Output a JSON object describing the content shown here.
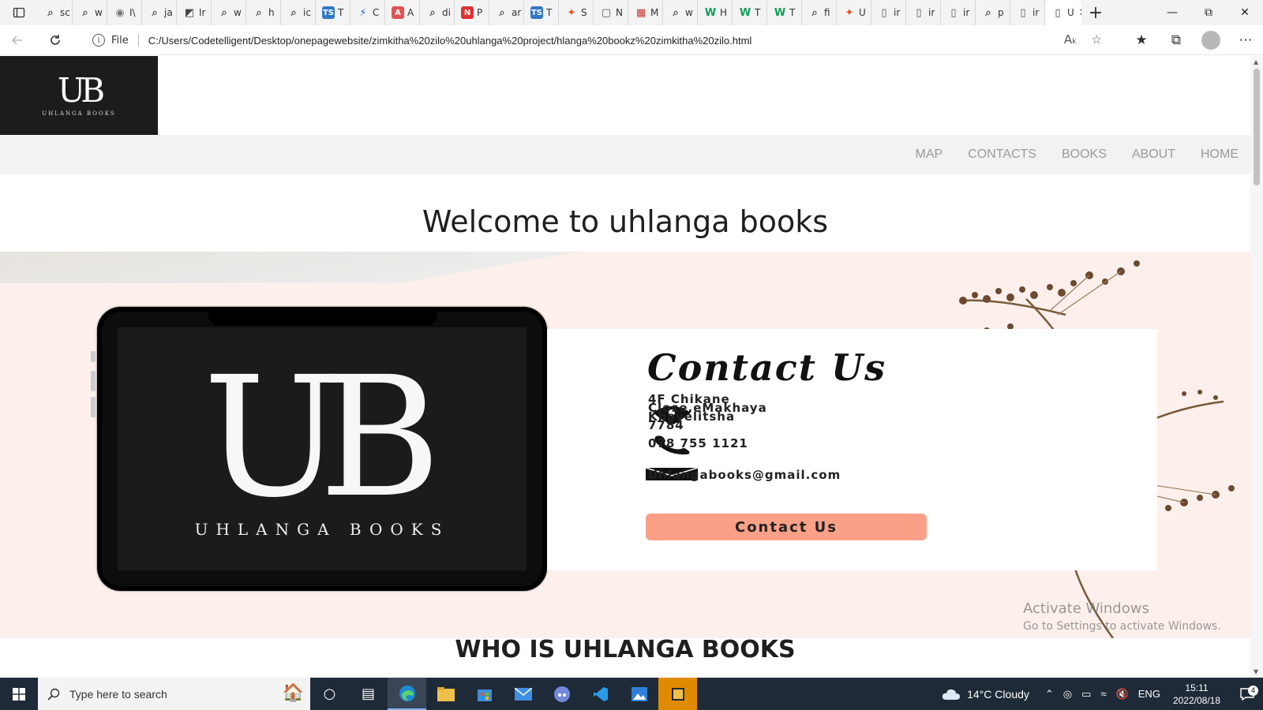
{
  "browser": {
    "tabs": [
      {
        "label": "sc",
        "icon": "search-icon"
      },
      {
        "label": "w",
        "icon": "search-icon"
      },
      {
        "label": "I\\",
        "icon": "account-icon"
      },
      {
        "label": "ja",
        "icon": "search-icon"
      },
      {
        "label": "Ir",
        "icon": "image-icon"
      },
      {
        "label": "w",
        "icon": "search-icon"
      },
      {
        "label": "h",
        "icon": "search-icon"
      },
      {
        "label": "ic",
        "icon": "search-icon"
      },
      {
        "label": "T",
        "icon": "ts-icon"
      },
      {
        "label": "C",
        "icon": "bolt-icon"
      },
      {
        "label": "A",
        "icon": "a-icon"
      },
      {
        "label": "di",
        "icon": "search-icon"
      },
      {
        "label": "P",
        "icon": "new-icon"
      },
      {
        "label": "ar",
        "icon": "search-icon"
      },
      {
        "label": "T",
        "icon": "ts-icon"
      },
      {
        "label": "S",
        "icon": "figma-icon"
      },
      {
        "label": "N",
        "icon": "window-icon"
      },
      {
        "label": "M",
        "icon": "calendar-icon"
      },
      {
        "label": "w",
        "icon": "search-icon"
      },
      {
        "label": "H",
        "icon": "w-icon"
      },
      {
        "label": "T",
        "icon": "w-icon"
      },
      {
        "label": "T",
        "icon": "w-icon"
      },
      {
        "label": "fi",
        "icon": "search-icon"
      },
      {
        "label": "U",
        "icon": "figma-icon"
      },
      {
        "label": "ir",
        "icon": "file-icon"
      },
      {
        "label": "ir",
        "icon": "file-icon"
      },
      {
        "label": "ir",
        "icon": "file-icon"
      },
      {
        "label": "p",
        "icon": "search-icon"
      },
      {
        "label": "ir",
        "icon": "file-icon"
      }
    ],
    "active_tab": {
      "label": "U",
      "icon": "file-icon"
    },
    "address": {
      "scheme_label": "File",
      "url": "C:/Users/Codetelligent/Desktop/onepagewebsite/zimkitha%20zilo%20uhlanga%20project/hlanga%20bookz%20zimkitha%20zilo.html"
    }
  },
  "site": {
    "logo": {
      "mark": "UB",
      "text": "UHLANGA BOOKS"
    },
    "nav": [
      "MAP",
      "CONTACTS",
      "BOOKS",
      "ABOUT",
      "HOME"
    ],
    "welcome_heading": "Welcome to uhlanga books",
    "banner": {
      "phone_logo_mark": "UB",
      "phone_logo_text": "UHLANGA BOOKS",
      "contact_title": "Contact Us",
      "address": "4F Chikane\nClose,eMakhaya\nKhayelitsha\n7784",
      "phone": "078 755 1121",
      "email": "Uhlangabooks@gmail.com",
      "button_label": "Contact Us"
    },
    "section_heading": "WHO IS UHLANGA BOOKS"
  },
  "watermark": {
    "line1": "Activate Windows",
    "line2": "Go to Settings to activate Windows."
  },
  "taskbar": {
    "search_placeholder": "Type here to search",
    "weather": "14°C  Cloudy",
    "language": "ENG",
    "time": "15:11",
    "date": "2022/08/18",
    "notification_count": "4"
  },
  "colors": {
    "banner_bg": "#fdf0ec",
    "button": "#f9a087",
    "nav_text": "#9a9a9a",
    "taskbar": "#1f2a38"
  }
}
